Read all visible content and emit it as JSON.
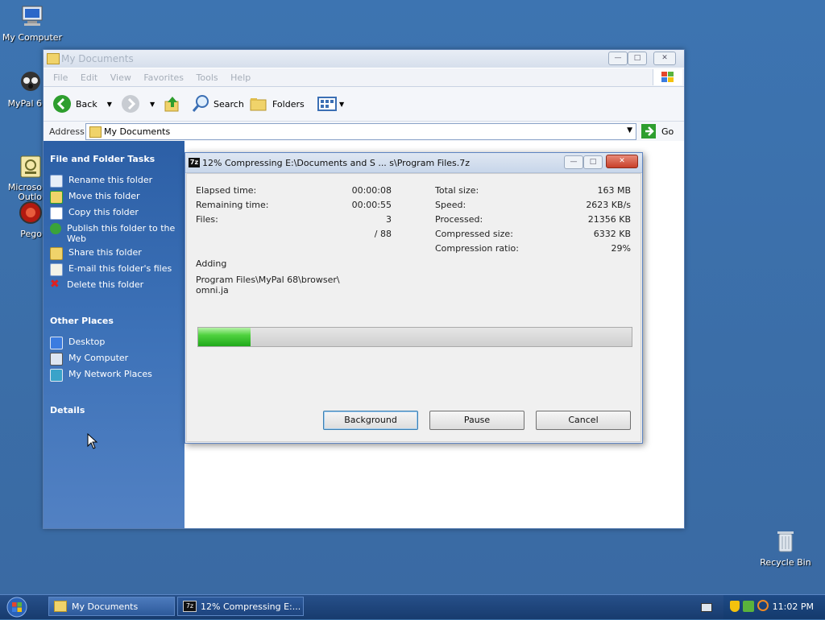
{
  "desktop": {
    "icons": [
      {
        "label": "My Computer"
      },
      {
        "label": "MyPal 6"
      },
      {
        "label": "Microso\nOutlo"
      },
      {
        "label": "Pego"
      },
      {
        "label": "Recycle Bin"
      }
    ]
  },
  "explorer": {
    "title": "My Documents",
    "menu": [
      "File",
      "Edit",
      "View",
      "Favorites",
      "Tools",
      "Help"
    ],
    "toolbar": {
      "back": "Back",
      "search": "Search",
      "folders": "Folders"
    },
    "address": {
      "label": "Address",
      "value": "My Documents",
      "go": "Go"
    },
    "file_tasks": {
      "heading": "File and Folder Tasks",
      "items": [
        "Rename this folder",
        "Move this folder",
        "Copy this folder",
        "Publish this folder to the Web",
        "Share this folder",
        "E-mail this folder's files",
        "Delete this folder"
      ]
    },
    "other_places": {
      "heading": "Other Places",
      "items": [
        "Desktop",
        "My Computer",
        "My Network Places"
      ]
    },
    "details": {
      "heading": "Details"
    }
  },
  "dialog": {
    "title": "12% Compressing E:\\Documents and S ... s\\Program Files.7z",
    "logo": "7z",
    "left_stats": [
      {
        "label": "Elapsed time:",
        "value": "00:00:08"
      },
      {
        "label": "Remaining time:",
        "value": "00:00:55"
      },
      {
        "label": "Files:",
        "value": "3"
      },
      {
        "label": "",
        "value": "/ 88"
      }
    ],
    "right_stats": [
      {
        "label": "Total size:",
        "value": "163 MB"
      },
      {
        "label": "Speed:",
        "value": "2623 KB/s"
      },
      {
        "label": "Processed:",
        "value": "21356 KB"
      },
      {
        "label": "Compressed size:",
        "value": "6332 KB"
      },
      {
        "label": "Compression ratio:",
        "value": "29%"
      }
    ],
    "action": "Adding",
    "current_file_line1": "Program Files\\MyPal 68\\browser\\",
    "current_file_line2": "omni.ja",
    "progress_percent": 12,
    "buttons": {
      "background": "Background",
      "pause": "Pause",
      "cancel": "Cancel"
    }
  },
  "taskbar": {
    "items": [
      "My Documents",
      "12% Compressing E:..."
    ],
    "clock": "11:02 PM"
  },
  "colors": {
    "desktop": "#3b6ea8",
    "task_pane": "#2c5fa6",
    "progress_fill": "#2cbb24"
  }
}
